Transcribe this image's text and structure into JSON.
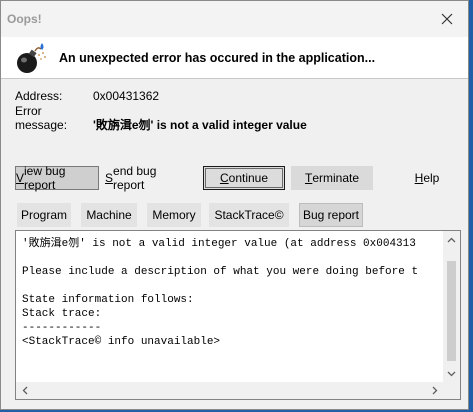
{
  "window": {
    "title": "Oops!",
    "header_message": "An unexpected error has occured in the application..."
  },
  "icons": {
    "close": "close-icon",
    "header": "bomb-icon"
  },
  "info": {
    "address_label": "Address:",
    "address_value": "0x00431362",
    "error_label": "Error message:",
    "error_value": "'敗旃湒e刎' is not a valid integer value"
  },
  "buttons": {
    "view_bug_report": {
      "key": "V",
      "rest": "iew bug report"
    },
    "send_bug_report": {
      "key": "S",
      "rest": "end bug report"
    },
    "continue": {
      "key": "C",
      "rest": "ontinue"
    },
    "terminate": {
      "key": "T",
      "rest": "erminate"
    },
    "help": {
      "key": "H",
      "rest": "elp"
    }
  },
  "tabs": [
    {
      "label": "Program"
    },
    {
      "label": "Machine"
    },
    {
      "label": "Memory"
    },
    {
      "label": "StackTrace©"
    },
    {
      "label": "Bug report",
      "active": true
    }
  ],
  "report": {
    "text": "'敗旃湒e刎' is not a valid integer value (at address 0x004313\n\nPlease include a description of what you were doing before t\n\nState information follows:\nStack trace:\n------------\n<StackTrace© info unavailable>"
  }
}
